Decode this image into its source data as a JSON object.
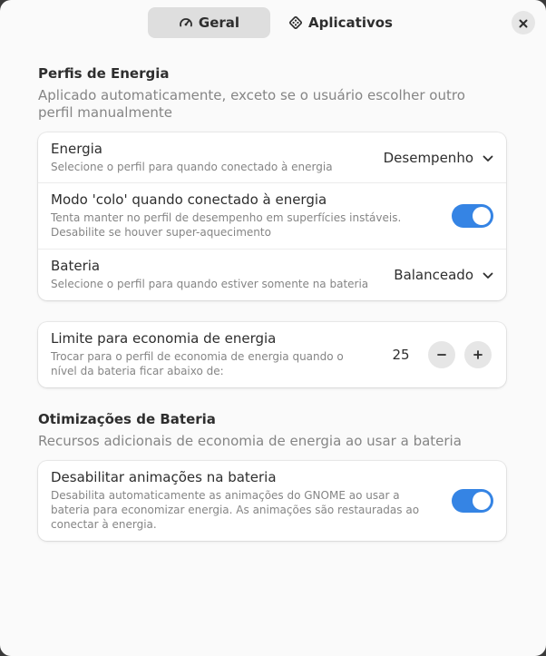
{
  "header": {
    "tabs": [
      {
        "label": "Geral",
        "icon": "speedometer-icon",
        "active": true
      },
      {
        "label": "Aplicativos",
        "icon": "apps-diamond-icon",
        "active": false
      }
    ]
  },
  "profiles": {
    "title": "Perfis de Energia",
    "subtitle": "Aplicado automaticamente, exceto se o usuário escolher outro perfil manualmente",
    "rows": [
      {
        "title": "Energia",
        "subtitle": "Selecione o perfil para quando conectado à energia",
        "value": "Desempenho"
      },
      {
        "title": "Modo 'colo' quando conectado à energia",
        "subtitle": "Tenta manter no perfil de desempenho em superfícies instáveis. Desabilite se houver super-aquecimento",
        "toggle": true
      },
      {
        "title": "Bateria",
        "subtitle": "Selecione o perfil para quando estiver somente na bateria",
        "value": "Balanceado"
      }
    ]
  },
  "saver": {
    "title": "Limite para economia de energia",
    "subtitle": "Trocar para o perfil de economia de energia quando o nível da bateria ficar abaixo de:",
    "value": "25",
    "minus": "−",
    "plus": "+"
  },
  "battery": {
    "title": "Otimizações de Bateria",
    "subtitle": "Recursos adicionais de economia de energia ao usar a bateria",
    "rows": [
      {
        "title": "Desabilitar animações na bateria",
        "subtitle": "Desabilita automaticamente as animações do GNOME ao usar a bateria para economizar energia. As animações são restauradas ao conectar à energia.",
        "toggle": true
      }
    ]
  },
  "colors": {
    "accent": "#3584e4",
    "window_bg": "#fafafa",
    "card_bg": "#ffffff"
  }
}
